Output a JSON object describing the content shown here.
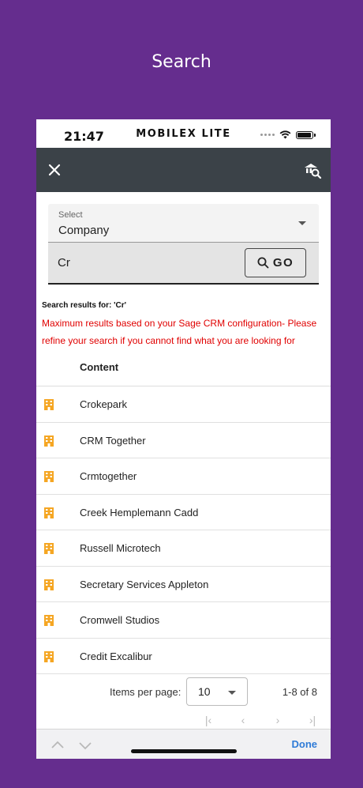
{
  "caption": "Search",
  "status_bar": {
    "time": "21:47",
    "app_title": "MOBILEX LITE"
  },
  "search": {
    "select_label": "Select",
    "select_value": "Company",
    "query": "Cr",
    "go_label": "GO"
  },
  "results_for": "Search results for:  'Cr'",
  "warning": "Maximum results based on your Sage CRM configuration- Please refine your search if you cannot find what you are looking for",
  "column_header": "Content",
  "results": [
    {
      "name": "Crokepark",
      "icon": "building-icon"
    },
    {
      "name": "CRM Together",
      "icon": "building-icon"
    },
    {
      "name": "Crmtogether",
      "icon": "building-icon"
    },
    {
      "name": "Creek Hemplemann Cadd",
      "icon": "building-icon"
    },
    {
      "name": "Russell Microtech",
      "icon": "building-icon"
    },
    {
      "name": "Secretary Services Appleton",
      "icon": "building-icon"
    },
    {
      "name": "Cromwell Studios",
      "icon": "building-icon"
    },
    {
      "name": "Credit Excalibur",
      "icon": "building-icon"
    }
  ],
  "paginator": {
    "items_per_page_label": "Items per page:",
    "items_per_page": "10",
    "range": "1-8 of 8"
  },
  "keyboard_bar": {
    "done_label": "Done"
  },
  "colors": {
    "background": "#652d8e",
    "toolbar": "#3b4248",
    "warning": "#e00000",
    "icon": "#f5a623",
    "done": "#2f7bd7"
  }
}
